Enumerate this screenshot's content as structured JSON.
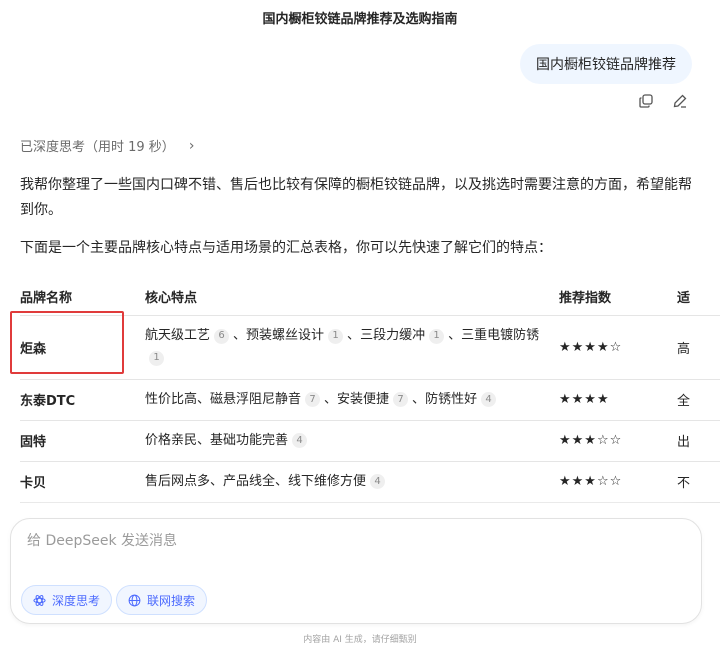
{
  "conversation": {
    "title": "国内橱柜铰链品牌推荐及选购指南"
  },
  "user_message": {
    "text": "国内橱柜铰链品牌推荐"
  },
  "message_actions": [
    {
      "icon": "copy-icon"
    },
    {
      "icon": "edit-icon"
    }
  ],
  "thinking": {
    "label": "已深度思考（用时 19 秒）"
  },
  "answer": {
    "paragraph1": "我帮你整理了一些国内口碑不错、售后也比较有保障的橱柜铰链品牌，以及挑选时需要注意的方面，希望能帮到你。",
    "paragraph2": "下面是一个主要品牌核心特点与适用场景的汇总表格，你可以先快速了解它们的特点："
  },
  "table": {
    "headers": [
      "品牌名称",
      "核心特点",
      "推荐指数",
      "适"
    ],
    "rows": [
      {
        "brand": "炬森",
        "features": [
          {
            "text": "航天级工艺",
            "cite": "6"
          },
          {
            "text": "预装螺丝设计",
            "cite": "1"
          },
          {
            "text": "三段力缓冲",
            "cite": "1"
          },
          {
            "text": "三重电镀防锈",
            "cite": "1"
          }
        ],
        "rating": "★★★★☆",
        "scene": "高"
      },
      {
        "brand": "东泰DTC",
        "features": [
          {
            "text": "性价比高、磁悬浮阻尼静音",
            "cite": "7"
          },
          {
            "text": "安装便捷",
            "cite": "7"
          },
          {
            "text": "防锈性好",
            "cite": "4"
          }
        ],
        "rating": "★★★★",
        "scene": "全"
      },
      {
        "brand": "固特",
        "features": [
          {
            "text": "价格亲民、基础功能完善",
            "cite": "4"
          }
        ],
        "rating": "★★★☆☆",
        "scene": "出"
      },
      {
        "brand": "卡贝",
        "features": [
          {
            "text": "售后网点多、产品线全、线下维修方便",
            "cite": "4"
          }
        ],
        "rating": "★★★☆☆",
        "scene": "不"
      }
    ],
    "separator": "、"
  },
  "highlight": {
    "color": "#e03b3b"
  },
  "composer": {
    "placeholder": "给 DeepSeek 发送消息",
    "deep_think_label": "深度思考",
    "web_search_label": "联网搜索"
  },
  "footer": {
    "disclaimer": "内容由 AI 生成，请仔细甄别"
  },
  "colors": {
    "accent": "#4d6bfe",
    "user_bubble": "#eff6ff"
  }
}
